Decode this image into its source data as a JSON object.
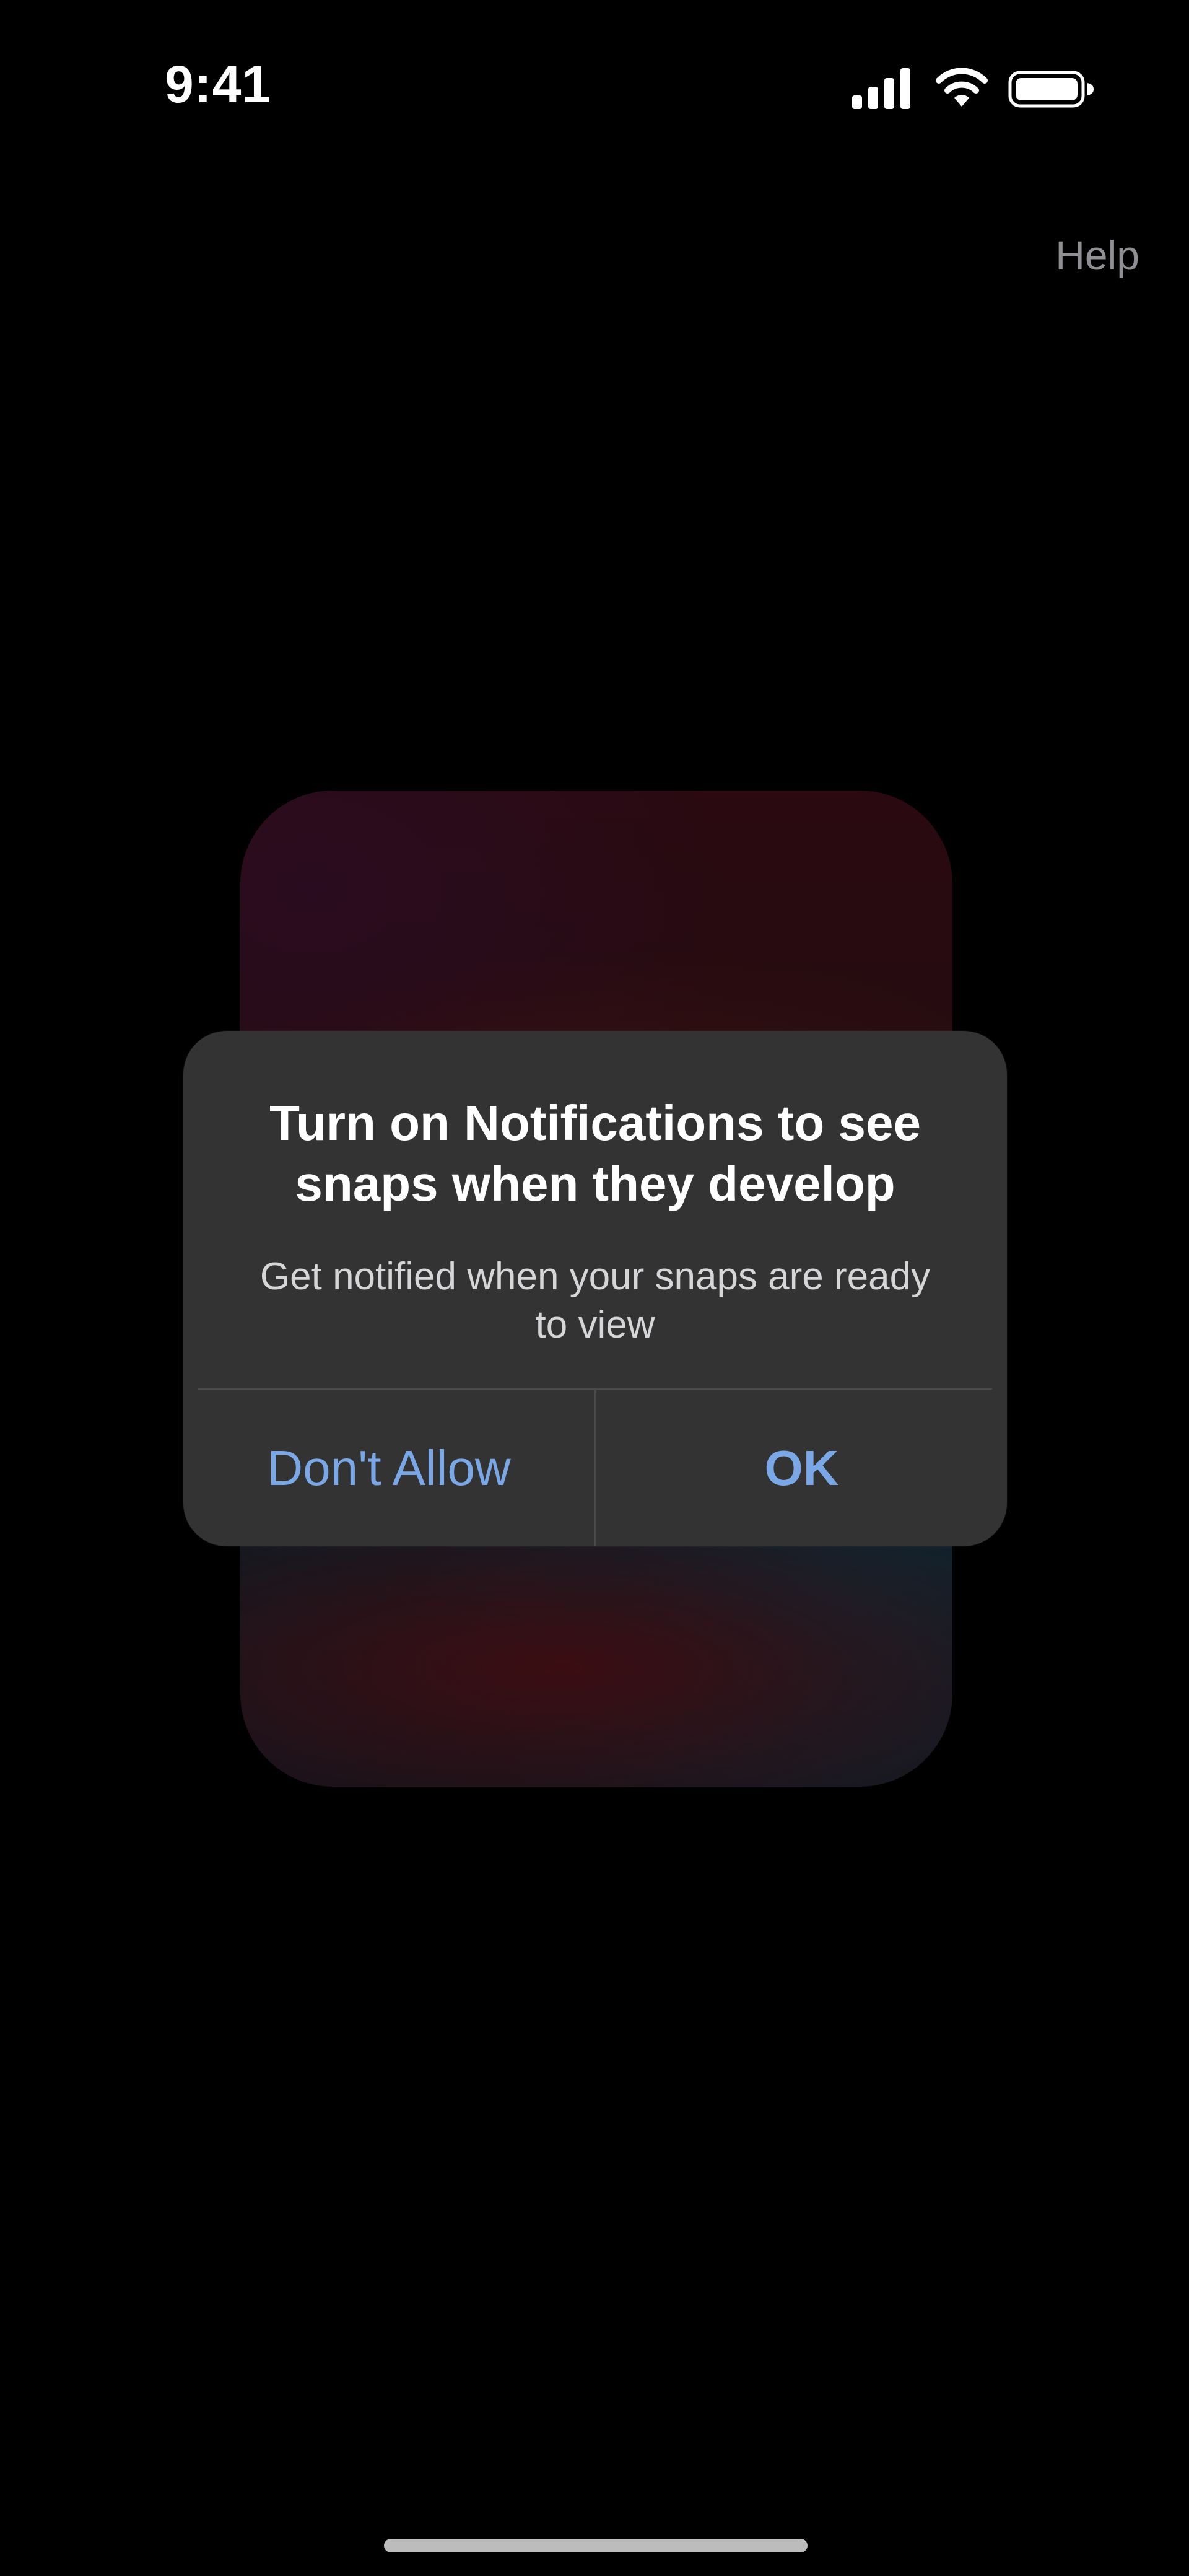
{
  "status_bar": {
    "time": "9:41",
    "icons": [
      "signal-icon",
      "wifi-icon",
      "battery-icon"
    ]
  },
  "header": {
    "help_label": "Help"
  },
  "alert": {
    "title": "Turn on Notifications to see snaps when they develop",
    "message": "Get notified when your snaps are ready to view",
    "buttons": {
      "dont_allow": "Don't Allow",
      "ok": "OK"
    }
  },
  "colors": {
    "background": "#000000",
    "alert_background": "#333334",
    "button_text": "#7aa7e6",
    "help_text": "#8e8e93"
  }
}
